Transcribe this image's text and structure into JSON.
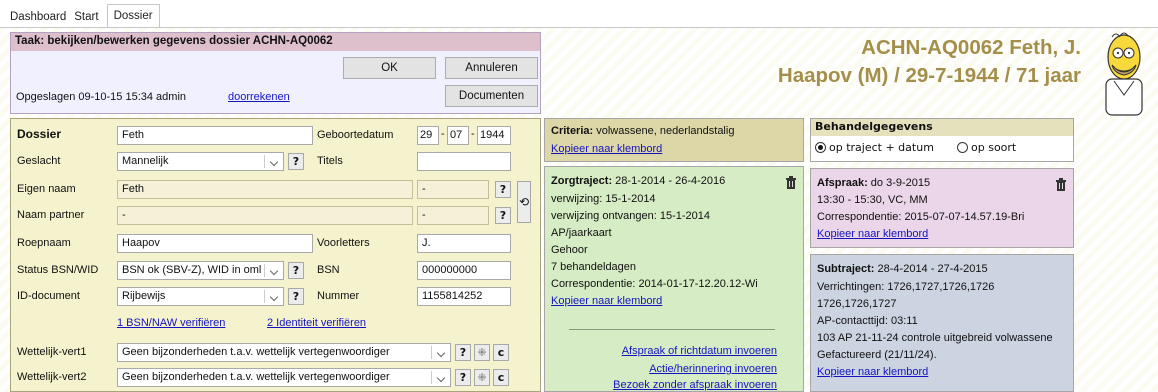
{
  "tabs": [
    "Dashboard",
    "Start",
    "Dossier"
  ],
  "task": {
    "title": "Taak: bekijken/bewerken gegevens dossier ACHN-AQ0062",
    "ok": "OK",
    "cancel": "Annuleren",
    "documents": "Documenten",
    "saved": "Opgeslagen 09-10-15 15:34 admin",
    "recalc": "doorrekenen"
  },
  "patient": {
    "line1": "ACHN-AQ0062 Feth, J.",
    "line2": "Haapov (M) / 29-7-1944 / 71 jaar"
  },
  "dossier": {
    "title": "Dossier",
    "dossier_value": "Feth",
    "birthdate_label": "Geboortedatum",
    "birth_day": "29",
    "birth_month": "07",
    "birth_year": "1944",
    "gender_label": "Geslacht",
    "gender_value": "Mannelijk",
    "titles_label": "Titels",
    "titles_value": "",
    "own_name_label": "Eigen naam",
    "own_name_value": "Feth",
    "own_name_extra": "-",
    "partner_label": "Naam partner",
    "partner_value": "-",
    "partner_extra": "-",
    "callname_label": "Roepnaam",
    "callname_value": "Haapov",
    "initials_label": "Voorletters",
    "initials_value": "J.",
    "bsn_status_label": "Status BSN/WID",
    "bsn_status_value": "BSN ok (SBV-Z), WID in oml",
    "bsn_label": "BSN",
    "bsn_value": "000000000",
    "id_label": "ID-document",
    "id_value": "Rijbewijs",
    "number_label": "Nummer",
    "number_value": "1155814252",
    "verify_bsn": "1 BSN/NAW verifiëren",
    "verify_id": "2 Identiteit verifiëren",
    "legal1_label": "Wettelijk-vert1",
    "legal1_value": "Geen bijzonderheden t.a.v. wettelijk vertegenwoordiger",
    "legal2_label": "Wettelijk-vert2",
    "legal2_value": "Geen bijzonderheden t.a.v. wettelijk vertegenwoordiger",
    "q": "?",
    "c": "c"
  },
  "criteria": {
    "label": "Criteria:",
    "value": " volwassene, nederlandstalig",
    "copy": "Kopieer naar klembord"
  },
  "zorgtraject": {
    "label": "Zorgtraject:",
    "range": " 28-1-2014 - 26-4-2016",
    "lines": [
      "verwijzing: 15-1-2014",
      "verwijzing ontvangen: 15-1-2014",
      "AP/jaarkaart",
      "Gehoor",
      "7 behandeldagen",
      "Correspondentie: 2014-01-17-12.20.12-Wi"
    ],
    "copy": "Kopieer naar klembord",
    "actions": [
      "Afspraak of richtdatum invoeren",
      "Actie/herinnering invoeren",
      "Bezoek zonder afspraak invoeren"
    ]
  },
  "behandel": {
    "title": "Behandelgegevens",
    "opt1": "op traject + datum",
    "opt2": "op soort"
  },
  "afspraak": {
    "label": "Afspraak:",
    "date": " do 3-9-2015",
    "time": "13:30 - 15:30, VC, MM",
    "corr": "Correspondentie: 2015-07-07-14.57.19-Bri",
    "copy": "Kopieer naar klembord"
  },
  "subtraject": {
    "label": "Subtraject:",
    "range": " 28-4-2014 - 27-4-2015",
    "lines": [
      "Verrichtingen: 1726,1727,1726,1726",
      "1726,1726,1727",
      "AP-contacttijd: 03:11",
      "103 AP 21-11-24 controle uitgebreid volwassene",
      "Gefactureerd (21/11/24)."
    ],
    "copy": "Kopieer naar klembord"
  }
}
